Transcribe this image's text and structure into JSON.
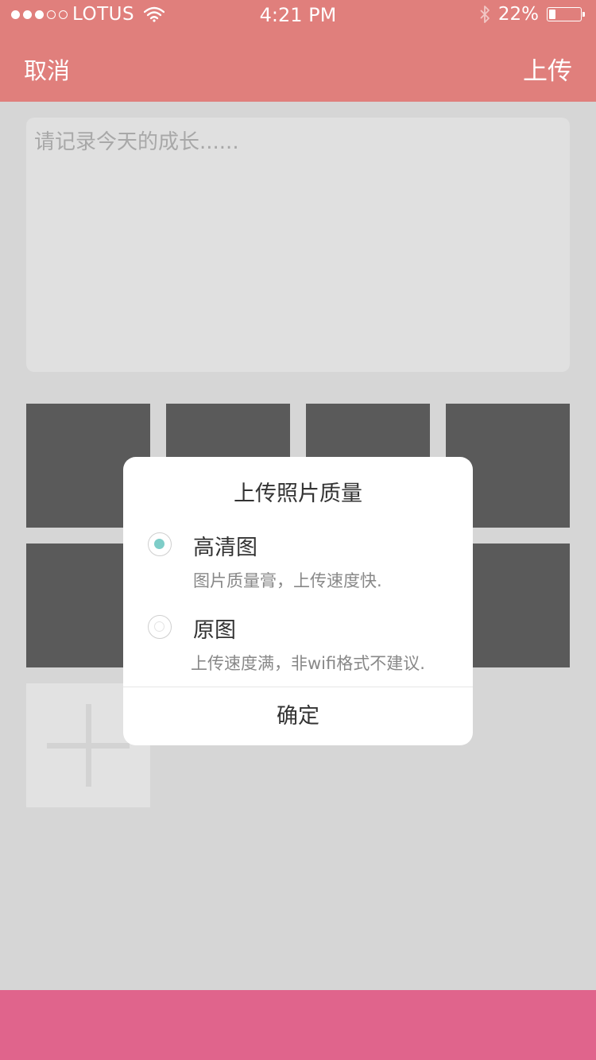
{
  "status_bar": {
    "carrier": "LOTUS",
    "signal_filled": 3,
    "signal_total": 5,
    "time": "4:21 PM",
    "battery_percent_text": "22%",
    "battery_level": 0.22
  },
  "nav": {
    "cancel_label": "取消",
    "upload_label": "上传"
  },
  "note": {
    "placeholder": "请记录今天的成长......"
  },
  "dialog": {
    "title": "上传照片质量",
    "options": [
      {
        "label": "高清图",
        "description": "图片质量膏，上传速度快.",
        "selected": true
      },
      {
        "label": "原图",
        "description": "上传速度满，非wifi格式不建议.",
        "selected": false
      }
    ],
    "confirm_label": "确定"
  },
  "colors": {
    "header": "#e07f7c",
    "bottom_bar": "#e0648c",
    "radio_accent": "#7ecdc8"
  },
  "icons": {
    "wifi": "wifi-icon",
    "bluetooth": "bluetooth-icon",
    "battery": "battery-icon",
    "add_photo": "plus-icon"
  }
}
